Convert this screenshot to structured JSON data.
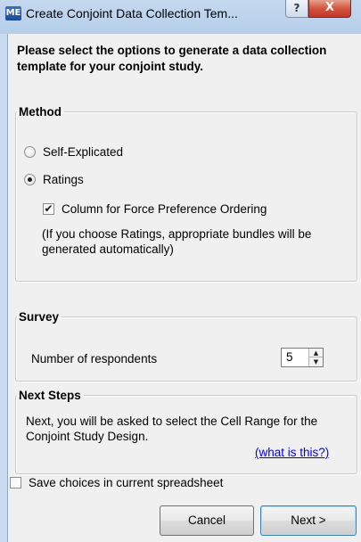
{
  "window": {
    "app_icon_label": "ME",
    "title": "Create Conjoint Data Collection Tem...",
    "help_glyph": "?",
    "close_glyph": "X"
  },
  "intro": "Please select the options to generate a data collection template for your conjoint study.",
  "method": {
    "legend": "Method",
    "options": [
      {
        "label": "Self-Explicated",
        "selected": false
      },
      {
        "label": "Ratings",
        "selected": true
      }
    ],
    "force_pref_checkbox": {
      "label": "Column for Force Preference Ordering",
      "checked": true
    },
    "note": "(If you choose Ratings, appropriate bundles will be generated automatically)"
  },
  "survey": {
    "legend": "Survey",
    "respondents_label": "Number of respondents",
    "respondents_value": "5"
  },
  "next_steps": {
    "legend": "Next Steps",
    "text": "Next, you will be asked to select the Cell Range for the Conjoint Study Design.",
    "link": "(what is this?)"
  },
  "save_choices": {
    "label": "Save choices in current spreadsheet",
    "checked": false
  },
  "buttons": {
    "cancel": "Cancel",
    "next": "Next >"
  },
  "icons": {
    "check": "✔",
    "spin_up": "▲",
    "spin_down": "▼"
  }
}
